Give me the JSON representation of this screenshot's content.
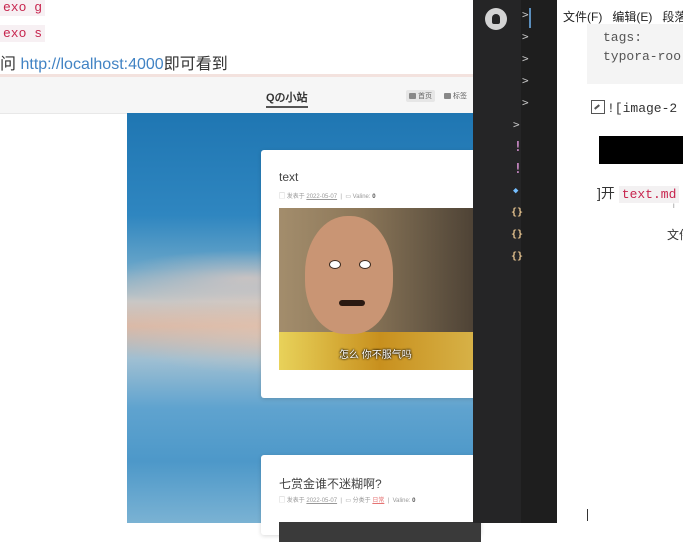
{
  "doc": {
    "line1": "exo g",
    "line2": "exo s",
    "url_prefix": "问",
    "url_text": "http://localhost:4000",
    "url_suffix": "即可看到"
  },
  "blog": {
    "logo": "Qの小站",
    "nav_home": "首页",
    "nav_tag": "标签",
    "post1": {
      "title": "text",
      "meta_prefix": "发表于",
      "date": "2022-05-07",
      "comments_label": "Valine:",
      "comments_count": "0",
      "image_caption": "怎么 你不服气吗"
    },
    "post2": {
      "title": "七赏金谁不迷糊啊?",
      "meta_prefix": "发表于",
      "date": "2022-05-07",
      "category_prefix": "分类于",
      "category": "日常",
      "comments_label": "Valine:",
      "comments_count": "0"
    }
  },
  "editor": {
    "tree_rows": [
      ">",
      ">",
      ">",
      ">",
      ">",
      ">",
      "!",
      "!",
      "◆",
      "{}",
      "{}",
      "{}"
    ]
  },
  "typora": {
    "menu": [
      "文件(F)",
      "编辑(E)",
      "段落"
    ],
    "yaml_line1": "tags:",
    "yaml_line2": "typora-roo",
    "image_md": "![image-2",
    "open_prefix": "]开",
    "open_file": "text.md",
    "tiny": "I",
    "wen": "文件"
  }
}
